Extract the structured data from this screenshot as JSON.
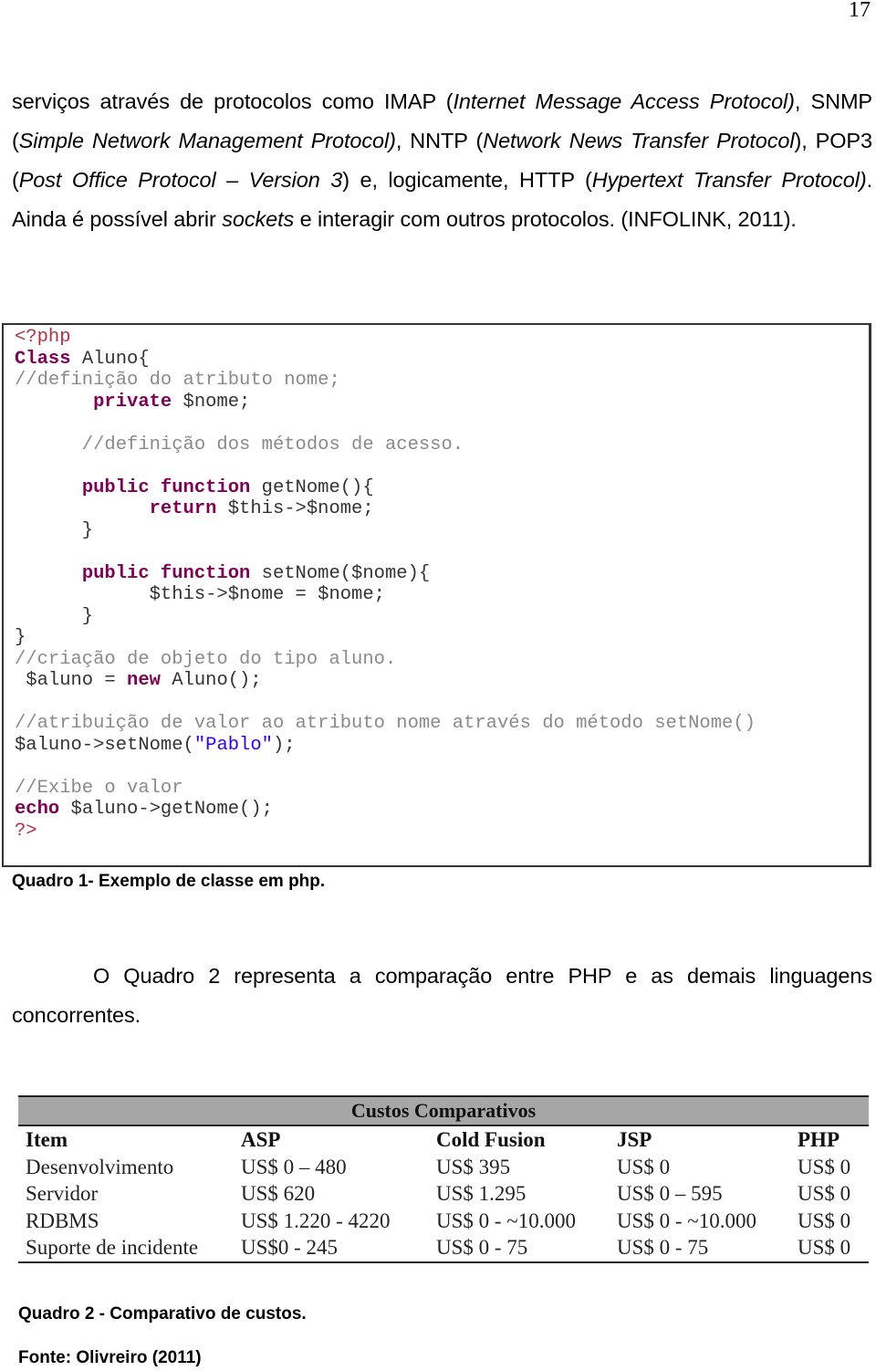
{
  "page": {
    "number": "17"
  },
  "paragraph1": {
    "segments": [
      {
        "t": "serviços através de protocolos como IMAP (",
        "i": false
      },
      {
        "t": "Internet Message Access Protocol)",
        "i": true
      },
      {
        "t": ", SNMP (",
        "i": false
      },
      {
        "t": "Simple Network Management Protocol)",
        "i": true
      },
      {
        "t": ", NNTP (",
        "i": false
      },
      {
        "t": "Network News Transfer Protocol",
        "i": true
      },
      {
        "t": "), POP3 (",
        "i": false
      },
      {
        "t": "Post Office Protocol – Version 3",
        "i": true
      },
      {
        "t": ") e, logicamente, HTTP (",
        "i": false
      },
      {
        "t": "Hypertext Transfer Protocol)",
        "i": true
      },
      {
        "t": ". Ainda é possível abrir ",
        "i": false
      },
      {
        "t": "sockets",
        "i": true
      },
      {
        "t": " e interagir com outros protocolos. (INFOLINK, 2011).",
        "i": false
      }
    ]
  },
  "code_block": {
    "lines": [
      [
        {
          "c": "php",
          "t": "<?php"
        }
      ],
      [
        {
          "c": "kw",
          "t": "Class"
        },
        {
          "c": "var",
          "t": " Aluno{"
        }
      ],
      [
        {
          "c": "cm",
          "t": "//definição do atributo nome;"
        }
      ],
      [
        {
          "c": "var",
          "t": "       "
        },
        {
          "c": "kw",
          "t": "private"
        },
        {
          "c": "var",
          "t": " $nome;"
        }
      ],
      [
        {
          "c": "var",
          "t": ""
        }
      ],
      [
        {
          "c": "cm",
          "t": "      //definição dos métodos de acesso."
        }
      ],
      [
        {
          "c": "var",
          "t": ""
        }
      ],
      [
        {
          "c": "var",
          "t": "      "
        },
        {
          "c": "kw",
          "t": "public function"
        },
        {
          "c": "var",
          "t": " getNome(){"
        }
      ],
      [
        {
          "c": "var",
          "t": "            "
        },
        {
          "c": "kw",
          "t": "return"
        },
        {
          "c": "var",
          "t": " $this->$nome;"
        }
      ],
      [
        {
          "c": "var",
          "t": "      }"
        }
      ],
      [
        {
          "c": "var",
          "t": ""
        }
      ],
      [
        {
          "c": "var",
          "t": "      "
        },
        {
          "c": "kw",
          "t": "public function"
        },
        {
          "c": "var",
          "t": " setNome($nome){"
        }
      ],
      [
        {
          "c": "var",
          "t": "            $this->$nome = $nome;"
        }
      ],
      [
        {
          "c": "var",
          "t": "      }"
        }
      ],
      [
        {
          "c": "var",
          "t": "}"
        }
      ],
      [
        {
          "c": "cm",
          "t": "//criação de objeto do tipo aluno."
        }
      ],
      [
        {
          "c": "var",
          "t": " $aluno = "
        },
        {
          "c": "kw",
          "t": "new"
        },
        {
          "c": "var",
          "t": " Aluno();"
        }
      ],
      [
        {
          "c": "var",
          "t": ""
        }
      ],
      [
        {
          "c": "cm",
          "t": "//atribuição de valor ao atributo nome através do método setNome()"
        }
      ],
      [
        {
          "c": "var",
          "t": "$aluno->setNome("
        },
        {
          "c": "str",
          "t": "\"Pablo\""
        },
        {
          "c": "var",
          "t": ");"
        }
      ],
      [
        {
          "c": "var",
          "t": ""
        }
      ],
      [
        {
          "c": "cm",
          "t": "//Exibe o valor"
        }
      ],
      [
        {
          "c": "kw",
          "t": "echo"
        },
        {
          "c": "var",
          "t": " $aluno->getNome();"
        }
      ],
      [
        {
          "c": "php",
          "t": "?>"
        }
      ]
    ]
  },
  "caption1": "Quadro 1- Exemplo de classe em php.",
  "paragraph2": "O Quadro 2 representa a comparação entre PHP e as demais linguagens concorrentes.",
  "cost_table": {
    "title": "Custos Comparativos",
    "headers": [
      "Item",
      "ASP",
      "Cold Fusion",
      "JSP",
      "PHP"
    ],
    "rows": [
      [
        "Desenvolvimento",
        "US$ 0 – 480",
        "US$ 395",
        "US$ 0",
        "US$ 0"
      ],
      [
        "Servidor",
        "US$ 620",
        "US$ 1.295",
        "US$ 0 – 595",
        "US$ 0"
      ],
      [
        "RDBMS",
        "US$ 1.220 - 4220",
        "US$ 0 - ~10.000",
        "US$ 0 - ~10.000",
        "US$ 0"
      ],
      [
        "Suporte de incidente",
        "US$0 - 245",
        "US$ 0 - 75",
        "US$ 0 - 75",
        "US$ 0"
      ]
    ]
  },
  "caption2": "Quadro 2 - Comparativo de custos.",
  "source": "Fonte: Olivreiro (2011)",
  "colors": {
    "keyword": "#7f0055",
    "comment": "#8a8a8a",
    "php_tag": "#b03040",
    "string": "#2a00ff",
    "table_header_bg": "#a6a6a6"
  }
}
